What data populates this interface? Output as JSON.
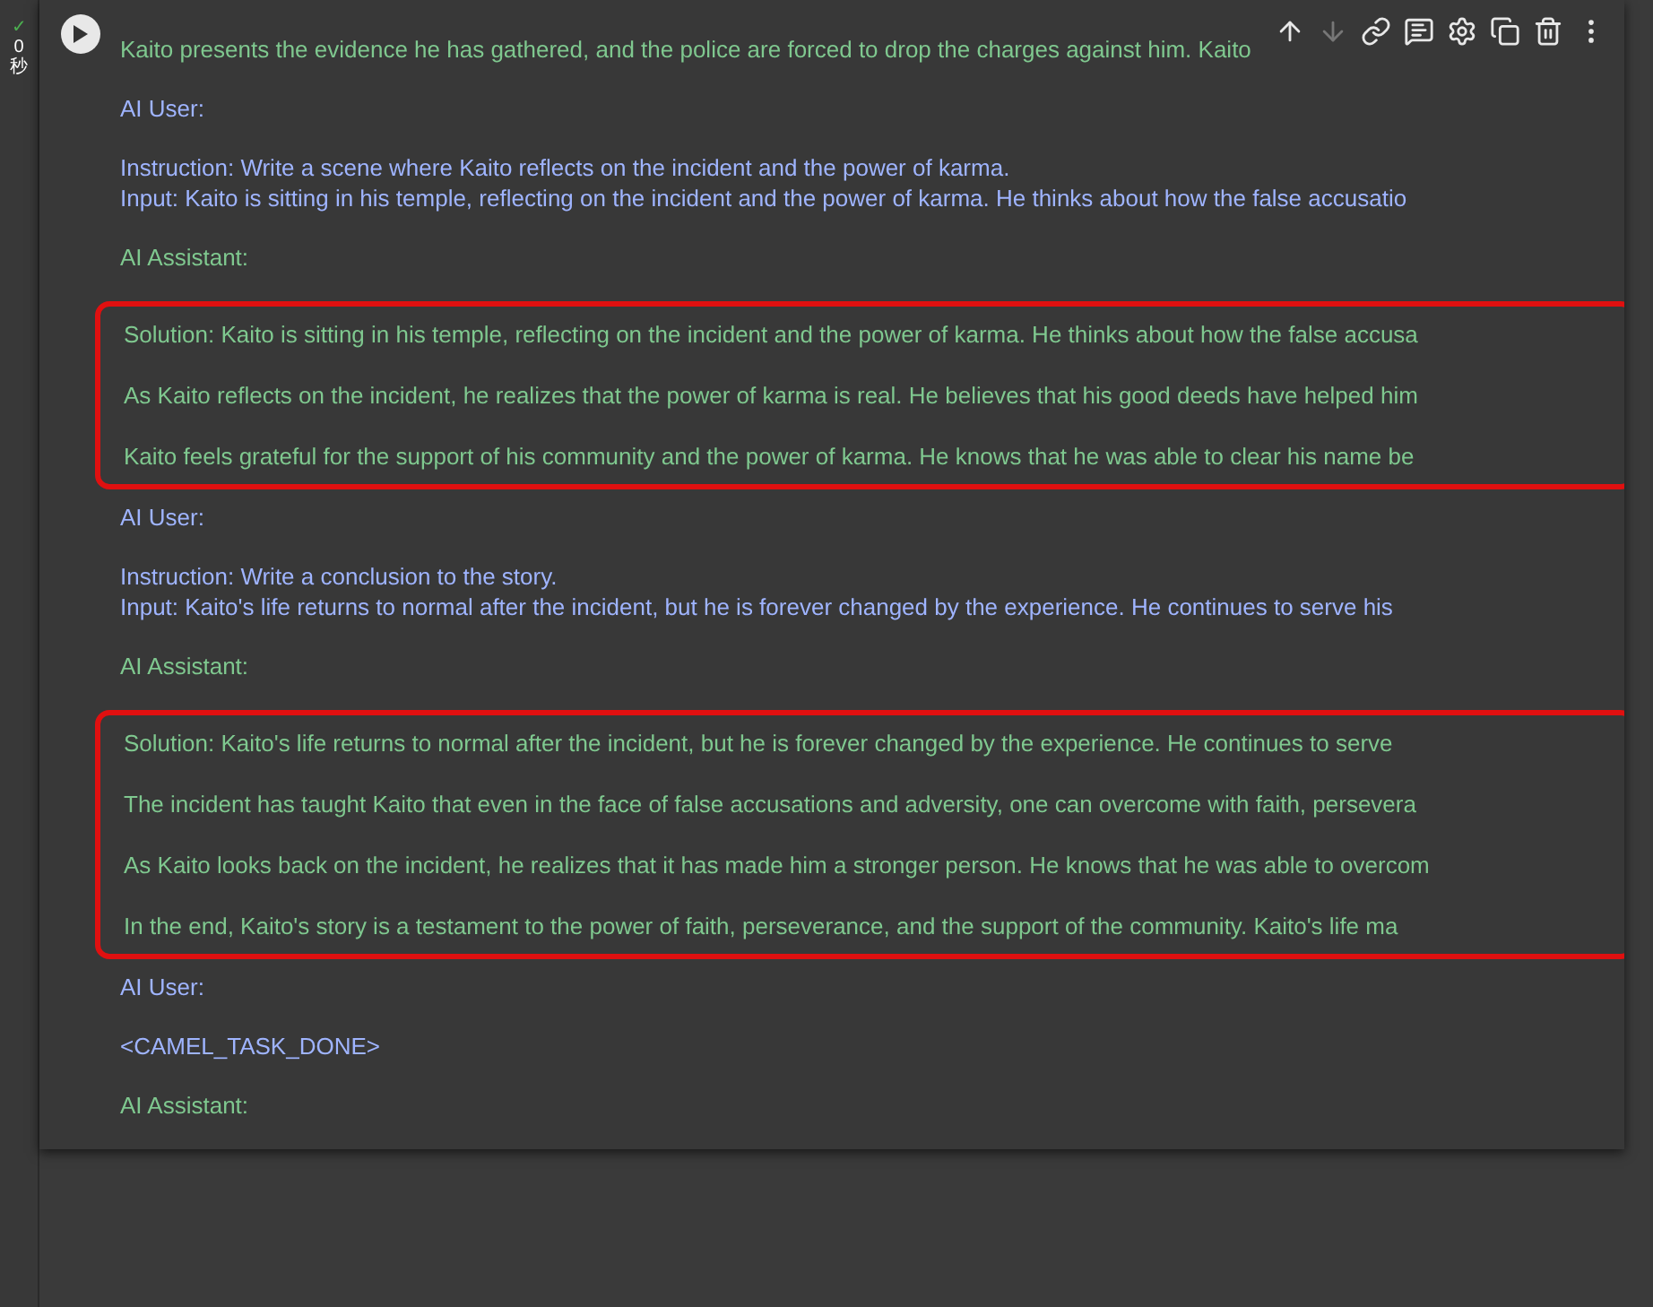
{
  "gutter": {
    "status": "✓",
    "elapsed": "0",
    "unit": "秒"
  },
  "toolbar": [
    {
      "disabled": false
    },
    {
      "disabled": true
    },
    {
      "disabled": false
    },
    {
      "disabled": false
    },
    {
      "disabled": false
    },
    {
      "disabled": false
    },
    {
      "disabled": false
    },
    {
      "disabled": false
    }
  ],
  "output": [
    {
      "kind": "paragraph",
      "color": "#7fc88f",
      "lines": [
        "Kaito presents the evidence he has gathered, and the police are forced to drop the charges against him. Kaito"
      ]
    },
    {
      "kind": "paragraph",
      "color": "#9fb4ff",
      "lines": [
        "AI User:"
      ]
    },
    {
      "kind": "paragraph",
      "color": "#9fb4ff",
      "lines": [
        "Instruction: Write a scene where Kaito reflects on the incident and the power of karma.",
        "Input: Kaito is sitting in his temple, reflecting on the incident and the power of karma. He thinks about how the false accusatio"
      ]
    },
    {
      "kind": "paragraph",
      "color": "#7fc88f",
      "lines": [
        "AI Assistant:"
      ]
    },
    {
      "kind": "boxed",
      "color": "#7fc88f",
      "lines": [
        "Solution: Kaito is sitting in his temple, reflecting on the incident and the power of karma. He thinks about how the false accusa",
        "As Kaito reflects on the incident, he realizes that the power of karma is real. He believes that his good deeds have helped him",
        "Kaito feels grateful for the support of his community and the power of karma. He knows that he was able to clear his name be"
      ]
    },
    {
      "kind": "paragraph",
      "color": "#9fb4ff",
      "lines": [
        "AI User:"
      ]
    },
    {
      "kind": "paragraph",
      "color": "#9fb4ff",
      "lines": [
        "Instruction: Write a conclusion to the story.",
        "Input: Kaito's life returns to normal after the incident, but he is forever changed by the experience. He continues to serve his"
      ]
    },
    {
      "kind": "paragraph",
      "color": "#7fc88f",
      "lines": [
        "AI Assistant:"
      ]
    },
    {
      "kind": "boxed",
      "color": "#7fc88f",
      "lines": [
        "Solution: Kaito's life returns to normal after the incident, but he is forever changed by the experience. He continues to serve",
        "The incident has taught Kaito that even in the face of false accusations and adversity, one can overcome with faith, persevera",
        "As Kaito looks back on the incident, he realizes that it has made him a stronger person. He knows that he was able to overcom",
        "In the end, Kaito's story is a testament to the power of faith, perseverance, and the support of the community. Kaito's life ma"
      ]
    },
    {
      "kind": "paragraph",
      "color": "#9fb4ff",
      "lines": [
        "AI User:"
      ]
    },
    {
      "kind": "paragraph",
      "color": "#9fb4ff",
      "lines": [
        "<CAMEL_TASK_DONE>"
      ]
    },
    {
      "kind": "paragraph",
      "color": "#7fc88f",
      "lines": [
        "AI Assistant:"
      ]
    }
  ]
}
